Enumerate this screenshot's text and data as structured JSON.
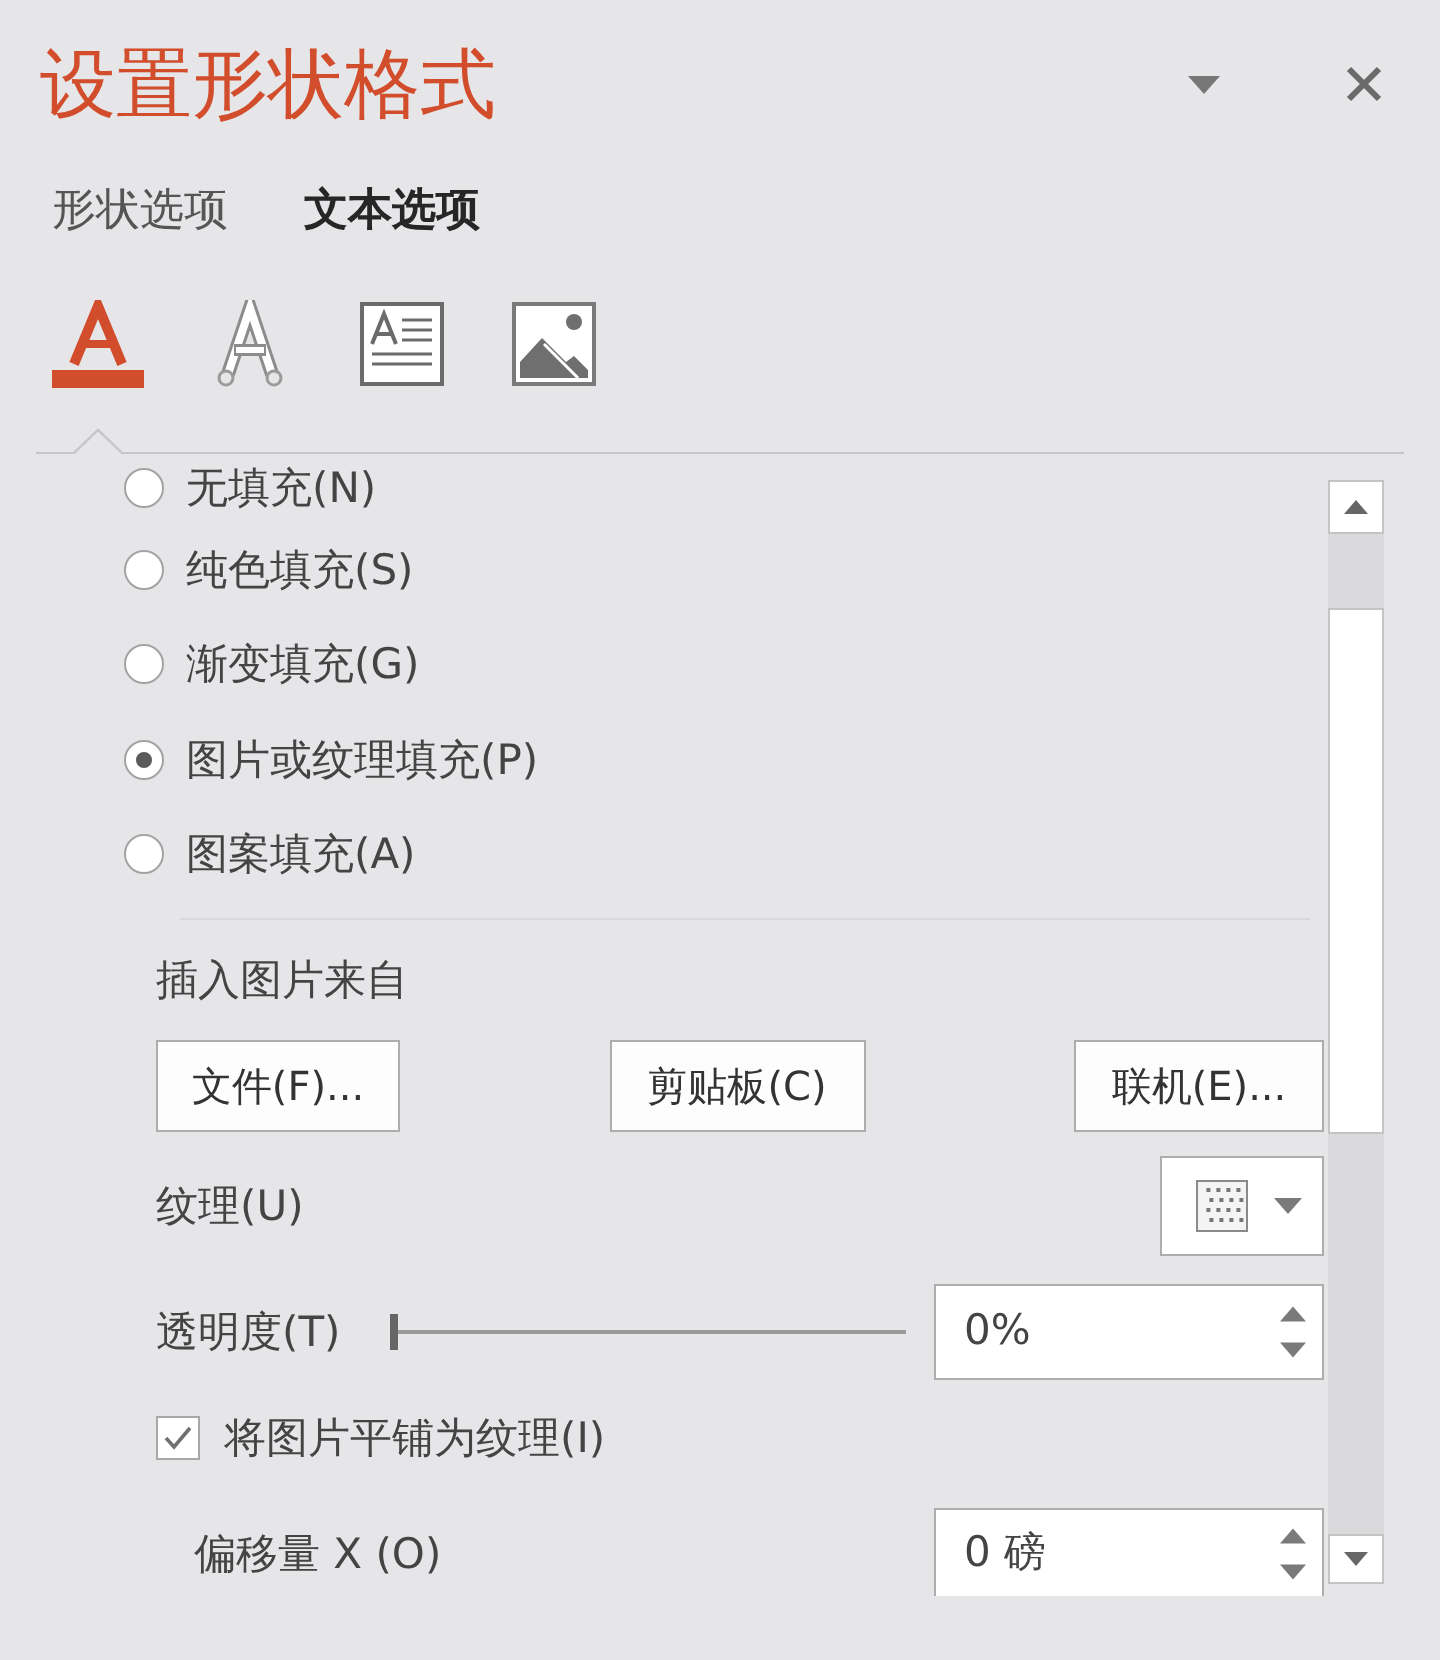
{
  "pane": {
    "title": "设置形状格式"
  },
  "tabs": [
    {
      "label": "形状选项",
      "selected": false
    },
    {
      "label": "文本选项",
      "selected": true
    }
  ],
  "format_icons": [
    {
      "kind": "text_fill",
      "selected": true
    },
    {
      "kind": "text_outline",
      "selected": false
    },
    {
      "kind": "text_box",
      "selected": false
    },
    {
      "kind": "picture",
      "selected": false
    }
  ],
  "fill_options": [
    {
      "label": "无填充(N)",
      "selected": false
    },
    {
      "label": "纯色填充(S)",
      "selected": false
    },
    {
      "label": "渐变填充(G)",
      "selected": false
    },
    {
      "label": "图片或纹理填充(P)",
      "selected": true
    },
    {
      "label": "图案填充(A)",
      "selected": false
    }
  ],
  "insert_picture": {
    "heading": "插入图片来自",
    "buttons": [
      "文件(F)...",
      "剪贴板(C)",
      "联机(E)..."
    ]
  },
  "texture": {
    "label": "纹理(U)"
  },
  "transparency": {
    "label": "透明度(T)",
    "level": 0,
    "value": "0%"
  },
  "tile_picture": {
    "label": "将图片平铺为纹理(I)",
    "checked": true
  },
  "offset_x": {
    "label": "偏移量 X (O)",
    "value": "0 磅"
  }
}
